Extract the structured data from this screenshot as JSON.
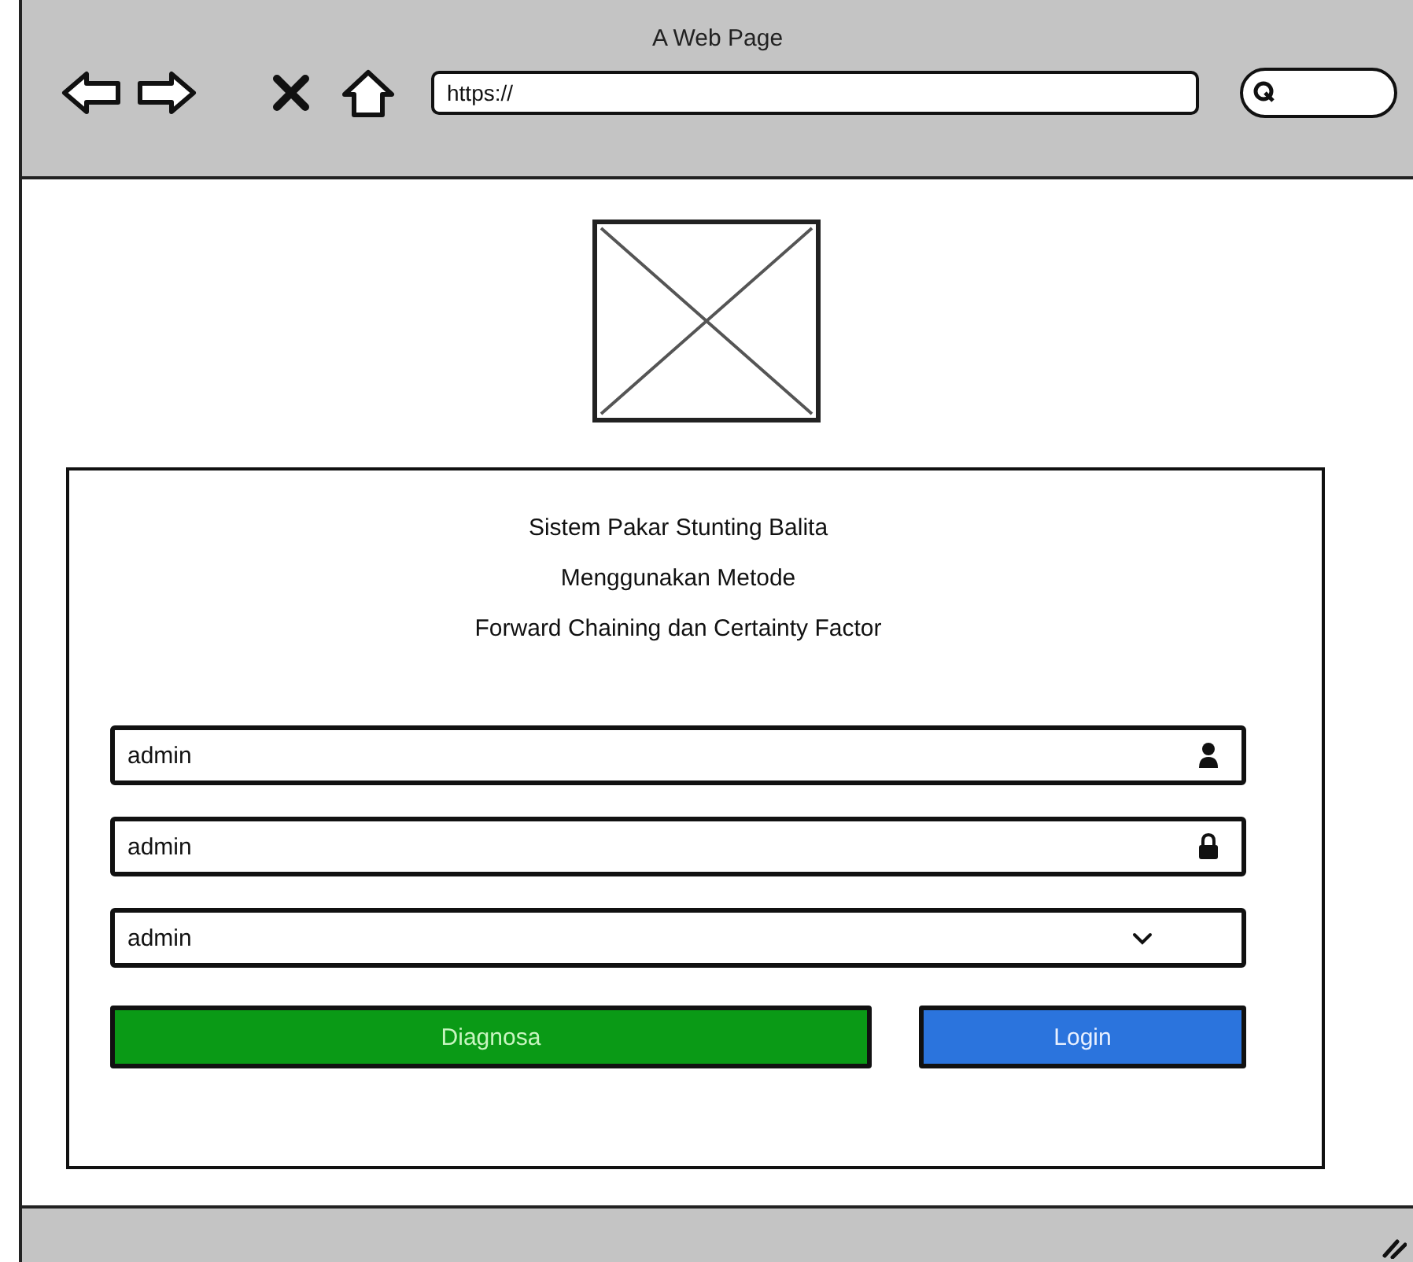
{
  "window": {
    "title": "A Web Page"
  },
  "browser": {
    "nav_buttons": [
      {
        "kind": "back"
      },
      {
        "kind": "forward"
      },
      {
        "kind": "stop"
      },
      {
        "kind": "home"
      }
    ],
    "address": "https://"
  },
  "login_card": {
    "title_lines": [
      "Sistem Pakar Stunting Balita",
      "Menggunakan Metode",
      "Forward Chaining dan Certainty Factor"
    ],
    "fields": [
      {
        "kind": "username",
        "value": "admin"
      },
      {
        "kind": "password",
        "value": "admin"
      },
      {
        "kind": "select",
        "value": "admin"
      }
    ],
    "buttons": [
      {
        "label": "Diagnosa",
        "color": "#0a9a16"
      },
      {
        "label": "Login",
        "color": "#2b74dd"
      }
    ]
  }
}
